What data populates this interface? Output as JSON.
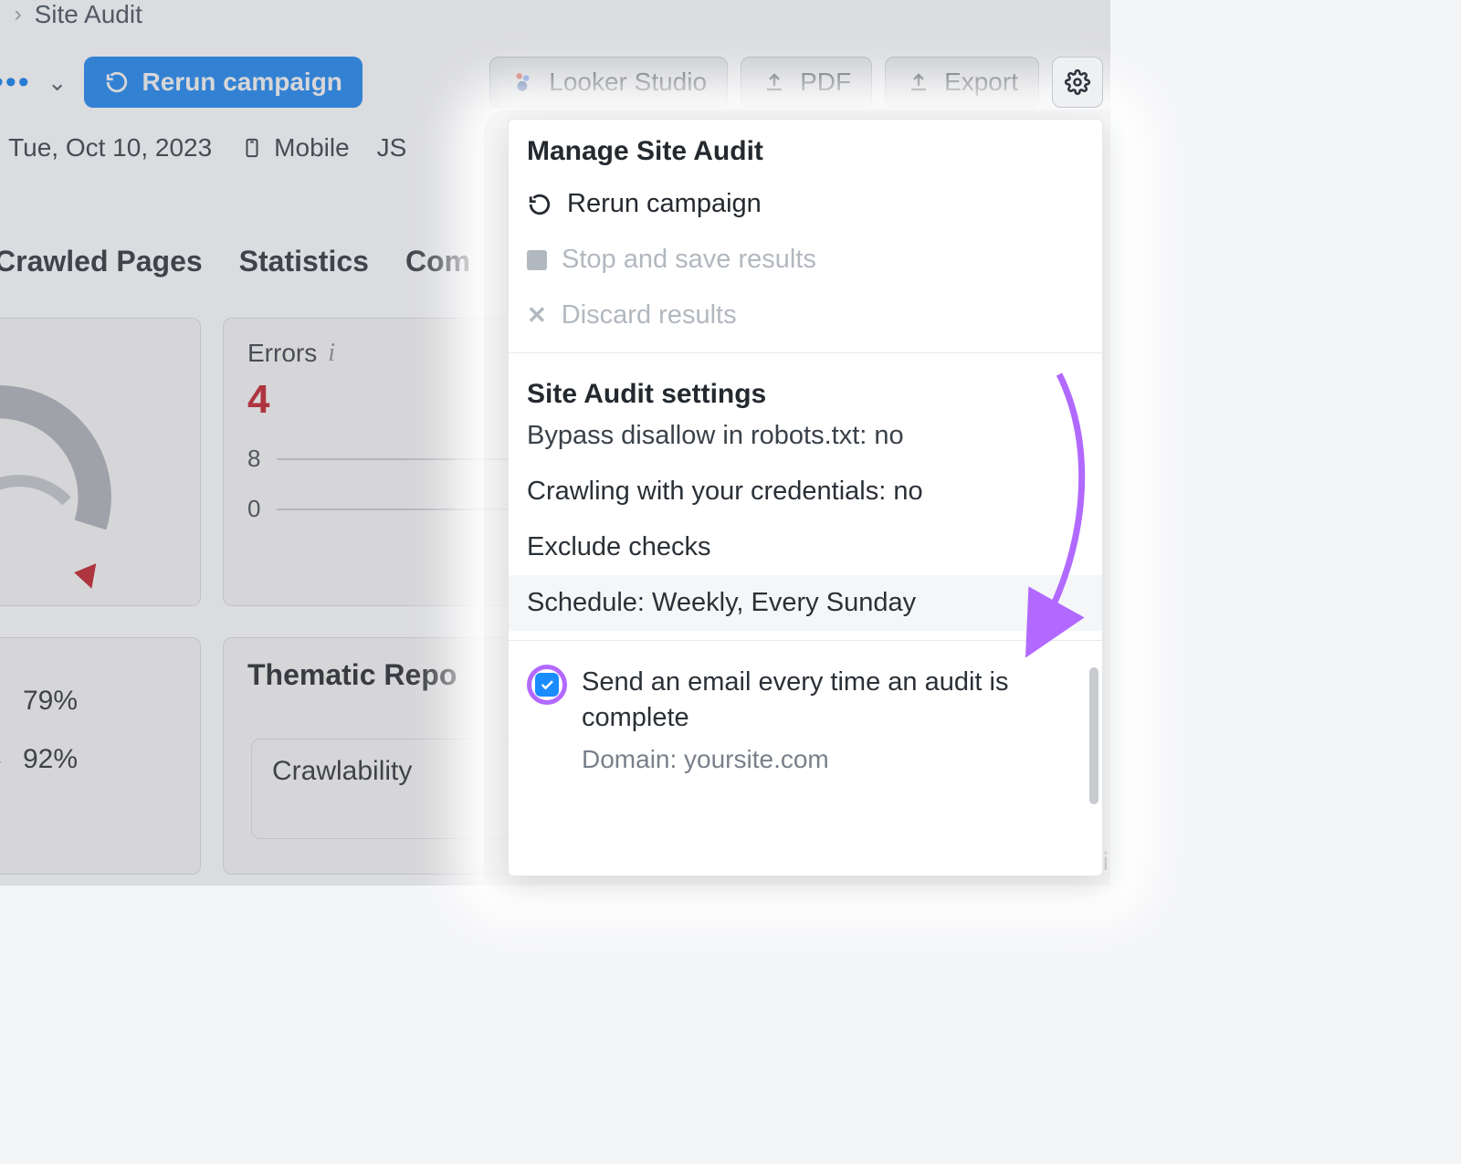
{
  "breadcrumb": {
    "prefix": "n",
    "current": "Site Audit"
  },
  "toolbar": {
    "rerun_label": "Rerun campaign",
    "looker_label": "Looker Studio",
    "pdf_label": "PDF",
    "export_label": "Export"
  },
  "meta": {
    "date_prefix": ":",
    "date": "Tue, Oct 10, 2023",
    "device": "Mobile",
    "js": "JS"
  },
  "tabs": {
    "crawled": "Crawled Pages",
    "stats": "Statistics",
    "compare": "Com"
  },
  "errors_card": {
    "label": "Errors",
    "value": "4",
    "axis_top": "8",
    "axis_bottom": "0"
  },
  "left2": {
    "val1": "79%",
    "val2": "92%"
  },
  "thematic": {
    "title": "Thematic Repo",
    "mini_label": "Crawlability"
  },
  "panel": {
    "title1": "Manage Site Audit",
    "rerun": "Rerun campaign",
    "stop": "Stop and save results",
    "discard": "Discard results",
    "title2": "Site Audit settings",
    "bypass": "Bypass disallow in robots.txt: no",
    "cred": "Crawling with your credentials: no",
    "exclude": "Exclude checks",
    "schedule": "Schedule: Weekly, Every Sunday",
    "notify": "Send an email every time an audit is complete",
    "domain": "Domain: yoursite.com"
  },
  "gear_status": "ti"
}
